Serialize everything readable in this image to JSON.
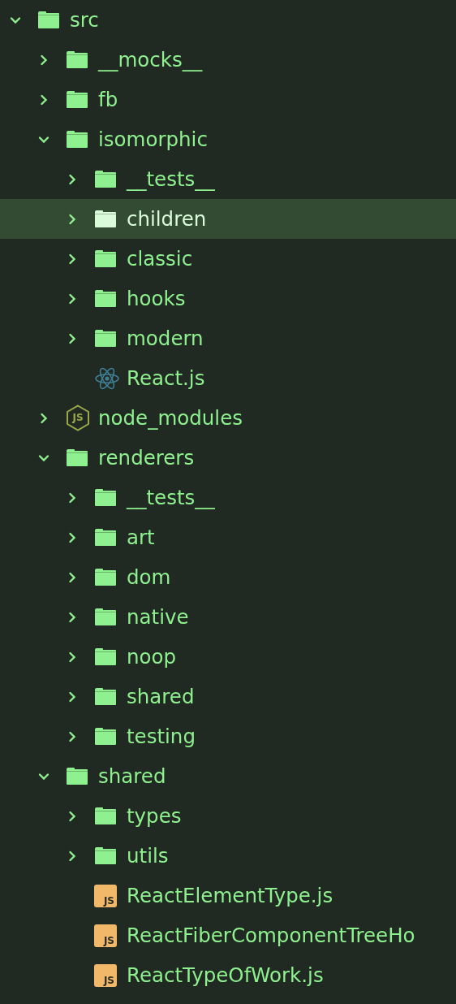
{
  "tree": [
    {
      "kind": "folder",
      "label": "src",
      "expanded": true,
      "selected": false,
      "children": [
        {
          "kind": "folder",
          "label": "__mocks__",
          "expanded": false,
          "selected": false
        },
        {
          "kind": "folder",
          "label": "fb",
          "expanded": false,
          "selected": false
        },
        {
          "kind": "folder",
          "label": "isomorphic",
          "expanded": true,
          "selected": false,
          "children": [
            {
              "kind": "folder",
              "label": "__tests__",
              "expanded": false,
              "selected": false
            },
            {
              "kind": "folder",
              "label": "children",
              "expanded": false,
              "selected": true
            },
            {
              "kind": "folder",
              "label": "classic",
              "expanded": false,
              "selected": false
            },
            {
              "kind": "folder",
              "label": "hooks",
              "expanded": false,
              "selected": false
            },
            {
              "kind": "folder",
              "label": "modern",
              "expanded": false,
              "selected": false
            },
            {
              "kind": "react-file",
              "label": "React.js",
              "selected": false
            }
          ]
        },
        {
          "kind": "node-folder",
          "label": "node_modules",
          "expanded": false,
          "selected": false,
          "icon_text": "JS"
        },
        {
          "kind": "folder",
          "label": "renderers",
          "expanded": true,
          "selected": false,
          "children": [
            {
              "kind": "folder",
              "label": "__tests__",
              "expanded": false,
              "selected": false
            },
            {
              "kind": "folder",
              "label": "art",
              "expanded": false,
              "selected": false
            },
            {
              "kind": "folder",
              "label": "dom",
              "expanded": false,
              "selected": false
            },
            {
              "kind": "folder",
              "label": "native",
              "expanded": false,
              "selected": false
            },
            {
              "kind": "folder",
              "label": "noop",
              "expanded": false,
              "selected": false
            },
            {
              "kind": "folder",
              "label": "shared",
              "expanded": false,
              "selected": false
            },
            {
              "kind": "folder",
              "label": "testing",
              "expanded": false,
              "selected": false
            }
          ]
        },
        {
          "kind": "folder",
          "label": "shared",
          "expanded": true,
          "selected": false,
          "children": [
            {
              "kind": "folder",
              "label": "types",
              "expanded": false,
              "selected": false
            },
            {
              "kind": "folder",
              "label": "utils",
              "expanded": false,
              "selected": false
            },
            {
              "kind": "js-file",
              "label": "ReactElementType.js",
              "selected": false,
              "icon_text": "JS"
            },
            {
              "kind": "js-file",
              "label": "ReactFiberComponentTreeHo",
              "selected": false,
              "icon_text": "JS"
            },
            {
              "kind": "js-file",
              "label": "ReactTypeOfWork.js",
              "selected": false,
              "icon_text": "JS"
            }
          ]
        }
      ]
    }
  ]
}
